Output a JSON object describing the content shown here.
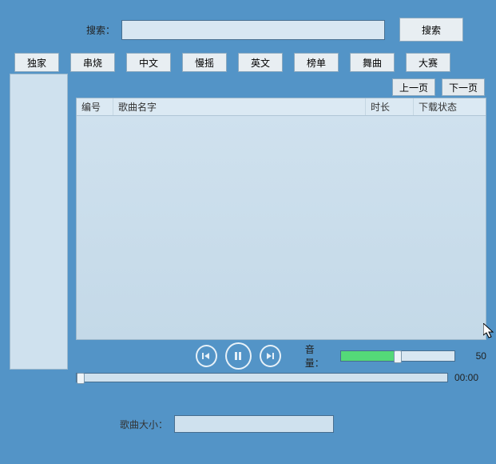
{
  "search": {
    "label": "搜索：",
    "value": "",
    "placeholder": "",
    "button": "搜索"
  },
  "categories": [
    "独家",
    "串烧",
    "中文",
    "慢摇",
    "英文",
    "榜单",
    "舞曲",
    "大赛"
  ],
  "pager": {
    "prev": "上一页",
    "next": "下一页"
  },
  "table": {
    "columns": {
      "id": "编号",
      "name": "歌曲名字",
      "dur": "时长",
      "stat": "下载状态"
    },
    "rows": []
  },
  "player": {
    "volume_label": "音量：",
    "volume": 50,
    "time": "00:00",
    "progress": 0
  },
  "size": {
    "label": "歌曲大小：",
    "value": ""
  }
}
